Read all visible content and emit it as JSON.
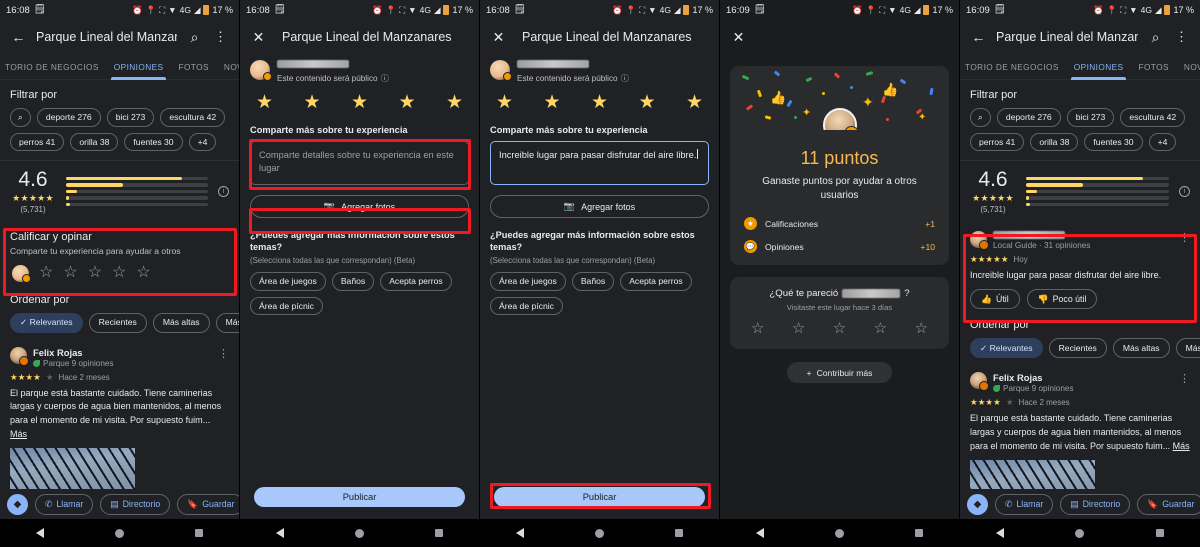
{
  "status_bar": {
    "time_a": "16:08",
    "time_b": "16:09",
    "battery": "17 %",
    "net": "4G",
    "icons": [
      "alarm-icon",
      "location-icon",
      "cast-icon",
      "wifi-icon",
      "signal-icon",
      "battery-icon"
    ]
  },
  "place": {
    "title_short": "Parque Lineal del Manzana...",
    "title_full": "Parque Lineal del Manzanares"
  },
  "tabs": [
    {
      "label": "TORIO DE NEGOCIOS",
      "active": false
    },
    {
      "label": "OPINIONES",
      "active": true
    },
    {
      "label": "FOTOS",
      "active": false
    },
    {
      "label": "NOVEDAD",
      "active": false
    }
  ],
  "filter": {
    "title": "Filtrar por",
    "chips": [
      "deporte 276",
      "bici 273",
      "escultura 42",
      "perros 41",
      "orilla 38",
      "fuentes 30",
      "+4"
    ]
  },
  "rating": {
    "score": "4.6",
    "stars": "★★★★★",
    "count": "(5,731)",
    "bars": [
      82,
      40,
      8,
      2,
      3
    ],
    "info_icon": "info-icon"
  },
  "rate_block": {
    "title": "Calificar y opinar",
    "subtitle": "Comparte tu experiencia para ayudar a otros",
    "stars": [
      "☆",
      "☆",
      "☆",
      "☆",
      "☆"
    ]
  },
  "order": {
    "title": "Ordenar por",
    "chips": [
      "Relevantes",
      "Recientes",
      "Más altas",
      "Más ba"
    ],
    "selected": "Relevantes"
  },
  "review_felix": {
    "name": "Felix Rojas",
    "meta": "Parque 9 opiniones",
    "stars_filled": "★★★★",
    "stars_empty": "★",
    "when": "Hace 2 meses",
    "body": "El parque está bastante cuidado. Tiene caminerias largas y cuerpos de agua bien mantenidos, al menos para el momento de mi visita.  Por supuesto fuim...",
    "more": "Más"
  },
  "review_new": {
    "meta": "Local Guide · 31 opiniones",
    "stars": "★★★★★",
    "when": "Hoy",
    "body": "Increible lugar para pasar disfrutar del aire libre.",
    "helpful": "Útil",
    "not_helpful": "Poco útil",
    "thumb_up_icon": "thumb-up-icon",
    "thumb_down_icon": "thumb-down-icon"
  },
  "action_bar": {
    "directions_icon": "directions-icon",
    "buttons": [
      "Llamar",
      "Directorio",
      "Guardar"
    ]
  },
  "compose": {
    "public_note": "Este contenido será público",
    "stars": [
      "★",
      "★",
      "★",
      "★",
      "★"
    ],
    "experience_label": "Comparte más sobre tu experiencia",
    "placeholder": "Comparte detalles sobre tu experiencia en este lugar",
    "typed_text": "Increible lugar para pasar disfrutar del aire libre.",
    "add_photos": "Agregar fotos",
    "add_photos_icon": "camera-icon",
    "topics_question": "¿Puedes agregar más información sobre estos temas?",
    "topics_sub": "(Selecciona todas las que correspondan)  (Beta)",
    "topics": [
      "Área de juegos",
      "Baños",
      "Acepta perros",
      "Área de pícnic"
    ],
    "publish": "Publicar"
  },
  "points": {
    "number": "11 puntos",
    "subtitle": "Ganaste puntos por ayudar a otros usuarios",
    "rows": [
      {
        "icon": "star-badge-icon",
        "label": "Calificaciones",
        "value": "+1"
      },
      {
        "icon": "review-badge-icon",
        "label": "Opiniones",
        "value": "+10"
      }
    ],
    "ask_prefix": "¿Qué te pareció",
    "ask_suffix": "?",
    "ask_sub": "Visitaste este lugar hace 3 días",
    "ask_stars": [
      "☆",
      "☆",
      "☆",
      "☆",
      "☆"
    ],
    "contribute": "Contribuir más",
    "plus_icon": "plus-icon"
  },
  "nav": {
    "back_icon": "nav-back-icon",
    "home_icon": "nav-home-icon",
    "recents_icon": "nav-recents-icon"
  },
  "colors": {
    "accent_blue": "#8ab4f8",
    "star_yellow": "#fdd663",
    "points_orange": "#f7b955",
    "highlight_red": "#ee1b24",
    "bg": "#202124"
  }
}
